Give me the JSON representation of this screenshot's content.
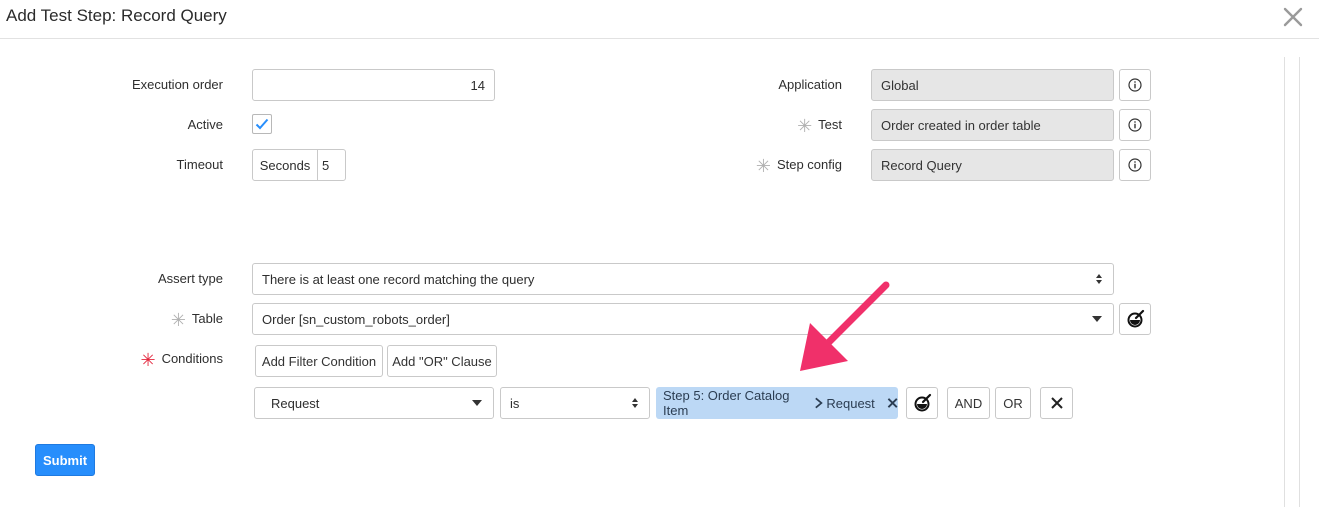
{
  "dialog": {
    "title": "Add Test Step: Record Query",
    "close_icon": "close-icon"
  },
  "fields": {
    "execution_order": {
      "label": "Execution order",
      "value": "14"
    },
    "active": {
      "label": "Active",
      "checked": true
    },
    "timeout": {
      "label": "Timeout",
      "unit": "Seconds",
      "value": "5"
    },
    "application": {
      "label": "Application",
      "value": "Global"
    },
    "test": {
      "label": "Test",
      "value": "Order created in order table",
      "required": true
    },
    "step_config": {
      "label": "Step config",
      "value": "Record Query",
      "required": true
    },
    "assert_type": {
      "label": "Assert type",
      "value": "There is at least one record matching the query"
    },
    "table": {
      "label": "Table",
      "value": "Order [sn_custom_robots_order]",
      "required": true
    },
    "conditions": {
      "label": "Conditions",
      "required": true
    }
  },
  "condition_buttons": {
    "add_filter": "Add Filter Condition",
    "add_or": "Add \"OR\" Clause"
  },
  "condition_row": {
    "field": "Request",
    "operator": "is",
    "value_part1": "Step 5: Order Catalog Item",
    "value_part2": "Request",
    "and_label": "AND",
    "or_label": "OR"
  },
  "submit_label": "Submit",
  "colors": {
    "accent": "#278efc",
    "required": "#e3273d",
    "arrow": "#f0306a",
    "chip": "#bcd8f5"
  }
}
